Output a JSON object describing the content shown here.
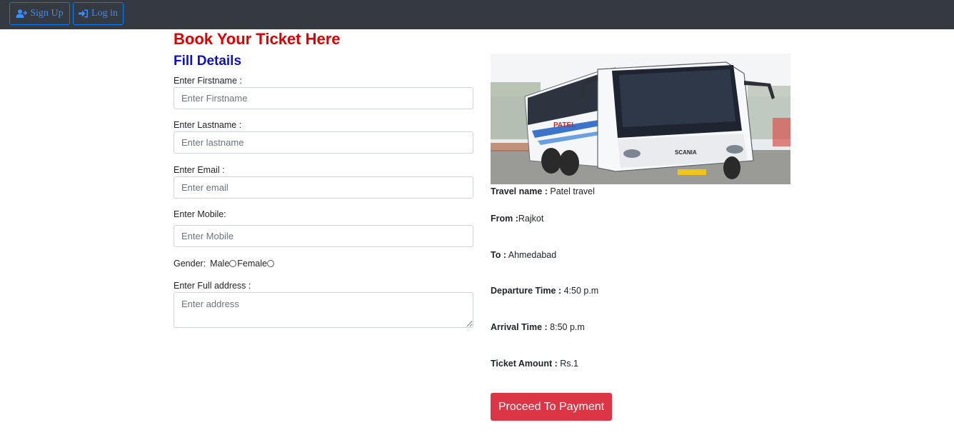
{
  "nav": {
    "signup_label": "Sign Up",
    "login_label": "Log in",
    "signup_icon": "user-plus-icon",
    "login_icon": "sign-in-icon"
  },
  "form": {
    "title": "Book Your Ticket Here",
    "subtitle": "Fill Details",
    "firstname": {
      "label": "Enter Firstname :",
      "placeholder": "Enter Firstname",
      "value": ""
    },
    "lastname": {
      "label": "Enter Lastname :",
      "placeholder": "Enter lastname",
      "value": ""
    },
    "email": {
      "label": "Enter Email :",
      "placeholder": "Enter email",
      "value": ""
    },
    "mobile": {
      "label": "Enter Mobile:",
      "placeholder": "Enter Mobile",
      "value": ""
    },
    "gender": {
      "label": "Gender:",
      "options": [
        "Male",
        "Female"
      ],
      "selected": ""
    },
    "address": {
      "label": "Enter Full address :",
      "placeholder": "Enter address",
      "value": ""
    }
  },
  "bus": {
    "travel_name_label": "Travel name :",
    "travel_name_value": " Patel travel",
    "from_label": "From :",
    "from_value": "Rajkot",
    "to_label": "To :",
    "to_value": " Ahmedabad",
    "departure_label": "Departure Time :",
    "departure_value": " 4:50 p.m",
    "arrival_label": "Arrival Time :",
    "arrival_value": " 8:50 p.m",
    "amount_label": "Ticket Amount :",
    "amount_value": " Rs.1",
    "photo_brand": "SCANIA",
    "photo_body_text": "PATEL"
  },
  "payment_button_label": "Proceed To Payment",
  "colors": {
    "navbar": "#343a40",
    "nav_button": "#007bff",
    "title": "#e00000",
    "subtitle": "#1010c8",
    "pay_button": "#dc3545"
  }
}
